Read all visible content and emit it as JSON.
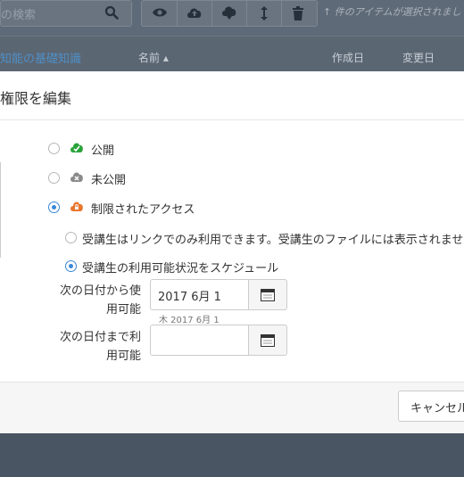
{
  "background": {
    "search": {
      "placeholder": "の検索"
    },
    "toolbar_icons": [
      "eye-icon",
      "cloud-upload-icon",
      "cloud-download-icon",
      "move-arrows-icon",
      "trash-icon"
    ],
    "selection_note": "↑ 件のアイテムが選択されまし",
    "breadcrumb": "知能の基礎知識",
    "columns": {
      "name": "名前 ▴",
      "created": "作成日",
      "modified": "変更日"
    }
  },
  "modal": {
    "title": "権限を編集",
    "options": [
      {
        "label": "公開",
        "icon": "cloud-check-icon",
        "selected": false,
        "color": "#2aa33a"
      },
      {
        "label": "未公開",
        "icon": "cloud-x-icon",
        "selected": false,
        "color": "#8a8a8a"
      },
      {
        "label": "制限されたアクセス",
        "icon": "cloud-lock-icon",
        "selected": true,
        "color": "#e8772e"
      }
    ],
    "sub_options": [
      {
        "label": "受講生はリンクでのみ利用できます。受講生のファイルには表示されませ",
        "selected": false
      },
      {
        "label": "受講生の利用可能状況をスケジュール",
        "selected": true
      }
    ],
    "from_label_1": "次の日付から使",
    "from_label_2": "用可能",
    "from_value": "2017 6月 1",
    "from_hint": "木 2017 6月 1",
    "until_label_1": "次の日付まで利",
    "until_label_2": "用可能",
    "until_value": "",
    "cancel_label": "キャンセル"
  }
}
